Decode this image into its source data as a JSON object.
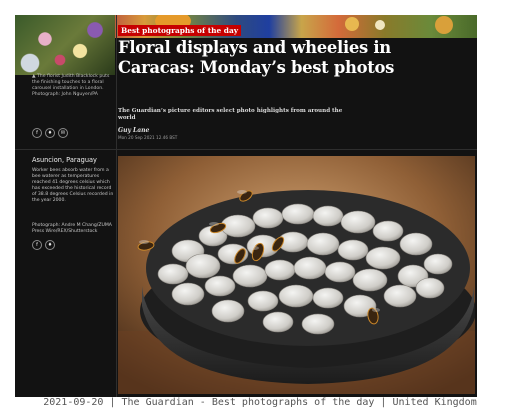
{
  "article": {
    "kicker": "Best photographs of the day",
    "headline": "Floral displays and wheelies in Caracas: Monday’s best photos",
    "standfirst": "The Guardian’s picture editors select photo highlights from around the world",
    "author": "Guy Lane",
    "timestamp": "Mon 20 Sep 2021 12.46 BST"
  },
  "thumbnail": {
    "caption": "▲ The florist Judith Blacklock puts the finishing touches to a floral carousel installation in London. Photograph: John Nguyen/PA"
  },
  "share_icons": [
    "facebook-icon",
    "twitter-icon",
    "email-icon"
  ],
  "share_glyphs": {
    "facebook": "f",
    "twitter": "♦",
    "email": "✉"
  },
  "photo_caption": {
    "location": "Asuncion, Paraguay",
    "text": "Worker bees absorb water from a bee waterer as temperatures reached 41 degrees celsius which has exceeded the historical record of 38.8 degrees Celsius recorded in the year 2000.",
    "credit": "Photograph: Andre M Chang/ZUMA Press Wire/REX/Shutterstock"
  },
  "footer": "2021-09-20 | The Guardian - Best photographs of the day | United Kingdom",
  "colors": {
    "background": "#121212",
    "kicker": "#c70000",
    "text": "#ffffff"
  }
}
